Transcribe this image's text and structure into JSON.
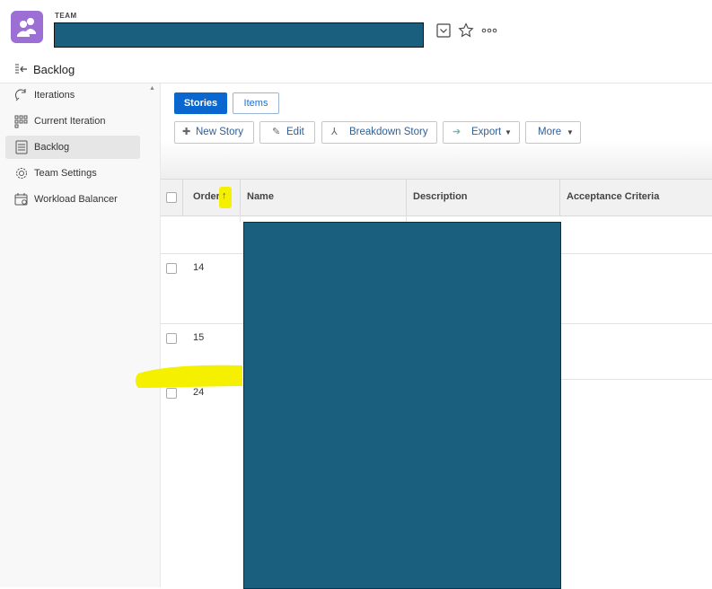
{
  "header": {
    "team_label": "TEAM",
    "team_name": "",
    "icons": [
      "chevron-down-box-icon",
      "star-icon",
      "more-icon"
    ]
  },
  "breadcrumb": {
    "label": "Backlog"
  },
  "sidebar": {
    "items": [
      {
        "label": "Iterations",
        "icon": "iterations-icon"
      },
      {
        "label": "Current Iteration",
        "icon": "current-iteration-icon"
      },
      {
        "label": "Backlog",
        "icon": "backlog-icon",
        "active": true
      },
      {
        "label": "Team Settings",
        "icon": "gear-icon"
      },
      {
        "label": "Workload Balancer",
        "icon": "calendar-icon"
      }
    ]
  },
  "tabs": {
    "stories": "Stories",
    "items": "Items"
  },
  "toolbar": {
    "new_story": "New Story",
    "edit": "Edit",
    "breakdown": "Breakdown Story",
    "export": "Export",
    "more": "More"
  },
  "grid": {
    "columns": {
      "order": "Order",
      "name": "Name",
      "description": "Description",
      "acceptance": "Acceptance Criteria"
    },
    "sort_indicator": "↑",
    "rows": [
      {
        "order": ""
      },
      {
        "order": "14"
      },
      {
        "order": "15"
      },
      {
        "order": "24"
      }
    ]
  },
  "colors": {
    "accent": "#0b67d0",
    "redaction": "#1b5f7f",
    "team_avatar": "#9b6fd4",
    "annotation": "#f4f000"
  }
}
